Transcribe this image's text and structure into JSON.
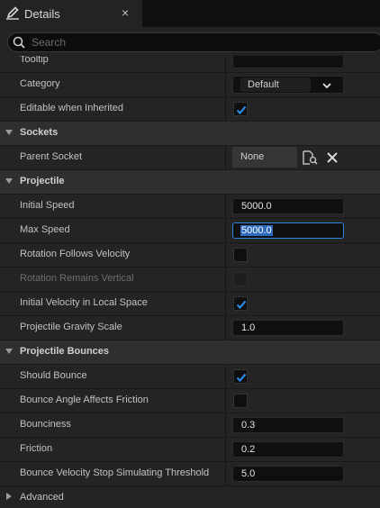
{
  "tab": {
    "title": "Details",
    "close": "×",
    "icon": "pencil-icon"
  },
  "search": {
    "placeholder": "Search",
    "value": "",
    "icon": "search-icon"
  },
  "colors": {
    "background": "#1a1a1a",
    "row": "#242424",
    "category": "#2f2f2f",
    "accent": "#2f86e0",
    "selection": "#2e6bbf"
  },
  "rows": {
    "tooltip": {
      "label": "Tooltip",
      "value": ""
    },
    "category": {
      "label": "Category",
      "value": "Default"
    },
    "editable_when_inherited": {
      "label": "Editable when Inherited",
      "checked": true
    },
    "sockets": {
      "label": "Sockets",
      "expanded": true
    },
    "parent_socket": {
      "label": "Parent Socket",
      "value": "None"
    },
    "projectile": {
      "label": "Projectile",
      "expanded": true
    },
    "initial_speed": {
      "label": "Initial Speed",
      "value": "5000.0"
    },
    "max_speed": {
      "label": "Max Speed",
      "value": "5000.0"
    },
    "rotation_follows_velocity": {
      "label": "Rotation Follows Velocity",
      "checked": false
    },
    "rotation_remains_vertical": {
      "label": "Rotation Remains Vertical",
      "checked": false,
      "disabled": true
    },
    "initial_velocity_local": {
      "label": "Initial Velocity in Local Space",
      "checked": true
    },
    "gravity_scale": {
      "label": "Projectile Gravity Scale",
      "value": "1.0"
    },
    "projectile_bounces": {
      "label": "Projectile Bounces",
      "expanded": true
    },
    "should_bounce": {
      "label": "Should Bounce",
      "checked": true
    },
    "bounce_angle_friction": {
      "label": "Bounce Angle Affects Friction",
      "checked": false
    },
    "bounciness": {
      "label": "Bounciness",
      "value": "0.3"
    },
    "friction": {
      "label": "Friction",
      "value": "0.2"
    },
    "bounce_stop_threshold": {
      "label": "Bounce Velocity Stop Simulating Threshold",
      "value": "5.0"
    },
    "advanced": {
      "label": "Advanced",
      "expanded": false
    }
  }
}
